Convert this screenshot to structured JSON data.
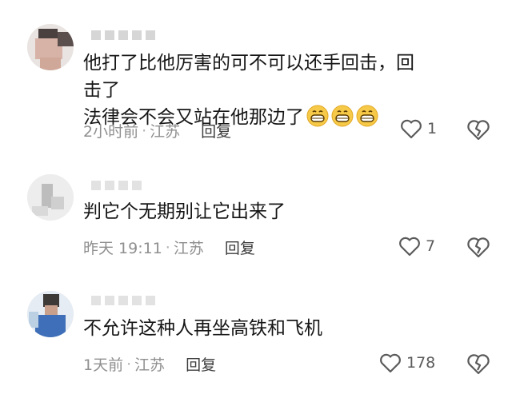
{
  "comments": [
    {
      "text_line1": "他打了比他厉害的可不可以还手回击，回击了",
      "text_line2": "法律会不会又站在他那边了",
      "emoji": "grinning-face-emoji",
      "time": "2小时前",
      "location": "江苏",
      "reply_label": "回复",
      "likes": "1"
    },
    {
      "text": "判它个无期别让它出来了",
      "time": "昨天 19:11",
      "location": "江苏",
      "reply_label": "回复",
      "likes": "7"
    },
    {
      "text": "不允许这种人再坐高铁和飞机",
      "time": "1天前",
      "location": "江苏",
      "reply_label": "回复",
      "likes": "178"
    }
  ],
  "icons": {
    "like": "heart-outline-icon",
    "dislike": "broken-heart-icon"
  },
  "colors": {
    "meta": "#8f8f8f",
    "text": "#161616",
    "icon": "#5a5a5a"
  }
}
